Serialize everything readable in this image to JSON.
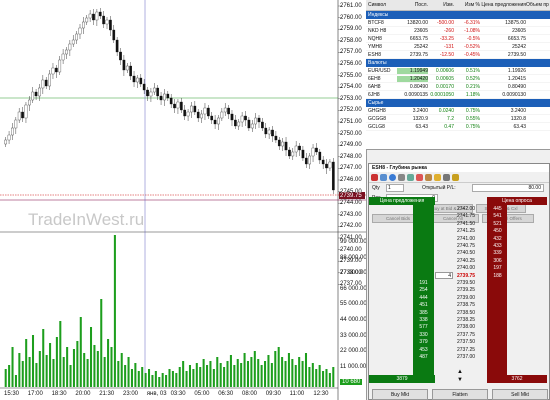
{
  "watermark": "TradeInWest.ru",
  "chart_data": {
    "type": "candlestick",
    "y_labels": [
      "2761.00",
      "2760.00",
      "2759.00",
      "2758.00",
      "2757.00",
      "2756.00",
      "2755.00",
      "2754.00",
      "2753.00",
      "2752.00",
      "2751.00",
      "2750.00",
      "2749.00",
      "2748.00",
      "2747.00",
      "2746.00",
      "2745.00",
      "2744.00",
      "2743.00",
      "2742.00",
      "2741.00",
      "2740.00",
      "2739.00",
      "2738.00",
      "2737.00"
    ],
    "last_price": "2739.75",
    "vol_labels": [
      "99 000.00",
      "88 000.00",
      "77 000.00",
      "66 000.00",
      "55 000.00",
      "44 000.00",
      "33 000.00",
      "22 000.00",
      "11 000.00",
      "10 680"
    ],
    "x_labels": [
      "15:30",
      "17:00",
      "18:30",
      "20:00",
      "21:30",
      "23:00",
      "янв, 03",
      "03:30",
      "05:00",
      "06:30",
      "08:00",
      "09:30",
      "11:00",
      "12:30"
    ]
  },
  "watchlist": {
    "headers": [
      "Символ",
      "Посл.",
      "Изм.",
      "Изм %",
      "Цена предложения",
      "Объем пр"
    ],
    "sections": [
      {
        "name": "Индексы",
        "rows": [
          [
            "BTCF8",
            "13820.00",
            "-500.00",
            "-6.31%",
            "13875.00",
            ""
          ],
          [
            "NKD H8",
            "23605",
            "-260",
            "-1.08%",
            "23605",
            ""
          ],
          [
            "NQH8",
            "6653.75",
            "-33.25",
            "-0.5%",
            "6653.75",
            ""
          ],
          [
            "YMH8",
            "25242",
            "-131",
            "-0.52%",
            "25242",
            ""
          ],
          [
            "ESH8",
            "2739.75",
            "-12.50",
            "-0.45%",
            "2739.50",
            ""
          ]
        ]
      },
      {
        "name": "Валюты",
        "rows": [
          [
            "EUR/USD",
            "1.19949",
            "0.00606",
            "0.51%",
            "1.19926",
            ""
          ],
          [
            "6EH8",
            "1.20420",
            "0.00605",
            "0.52%",
            "1.20415",
            ""
          ],
          [
            "6AH8",
            "0.80490",
            "0.00170",
            "0.21%",
            "0.80490",
            ""
          ],
          [
            "6JH8",
            "0.0090135",
            "0.0001050",
            "1.18%",
            "0.0090130",
            ""
          ]
        ]
      },
      {
        "name": "Сырье",
        "rows": [
          [
            "GHGH8",
            "3.2400",
            "0.0240",
            "0.75%",
            "3.2400",
            ""
          ],
          [
            "GCGG8",
            "1320.9",
            "7.2",
            "0.55%",
            "1320.8",
            ""
          ],
          [
            "GCLG8",
            "63.43",
            "0.47",
            "0.75%",
            "63.43",
            ""
          ]
        ]
      }
    ]
  },
  "dom": {
    "title": "ESH8 - Глубина рынка",
    "qty_label": "Qty",
    "qty_value": "1",
    "pl_label": "Открытый P/L:",
    "pl_value": "80.00",
    "pos_label": "Pos",
    "pos_value": "0",
    "buttons_row1": [
      "Buy at Bid & Cxl",
      "Sell at Ask & Cxl"
    ],
    "buttons_row2": [
      "Cancel Bids",
      "Cancel All",
      "Cancel Offers"
    ],
    "bid_header": "Цена предложения",
    "ask_header": "Цена опроса",
    "prices": [
      "2742.00",
      "2741.75",
      "2741.50",
      "2741.25",
      "2741.00",
      "2740.75",
      "2740.50",
      "2740.25",
      "2740.00",
      "2739.75",
      "2739.50",
      "2739.25",
      "2739.00",
      "2738.75",
      "2738.50",
      "2738.25",
      "2738.00",
      "2737.75",
      "2737.50",
      "2737.25",
      "2737.00"
    ],
    "marker": "4",
    "asks": [
      "445",
      "541",
      "521",
      "450",
      "432",
      "433",
      "339",
      "306",
      "197",
      "188"
    ],
    "bids": [
      "191",
      "254",
      "444",
      "451",
      "385",
      "338",
      "577",
      "330",
      "379",
      "453",
      "487"
    ],
    "bid_total": "3879",
    "ask_total": "3762",
    "bottom_buttons": [
      "Buy Mkt",
      "Flatten",
      "Sell Mkt"
    ]
  }
}
